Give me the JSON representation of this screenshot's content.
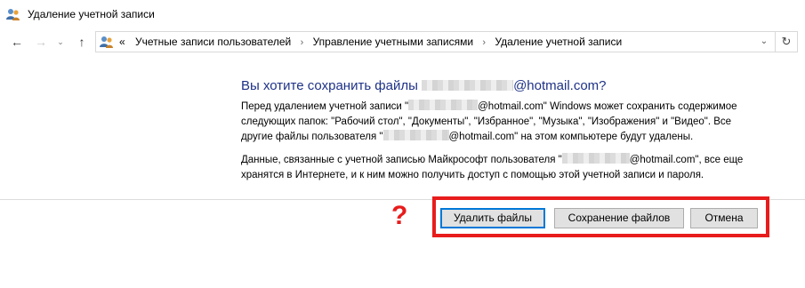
{
  "window": {
    "title": "Удаление учетной записи"
  },
  "nav": {
    "back_icon": "arrow-left-icon",
    "forward_icon": "arrow-right-icon",
    "recent_icon": "chevron-down-icon",
    "up_icon": "arrow-up-icon"
  },
  "address": {
    "overflow": "«",
    "breadcrumbs": [
      "Учетные записи пользователей",
      "Управление учетными записями",
      "Удаление учетной записи"
    ],
    "separator": "›",
    "dropdown_icon": "chevron-down-icon",
    "refresh_icon": "refresh-icon"
  },
  "content": {
    "heading_pre": "Вы хотите сохранить файлы ",
    "heading_post": "@hotmail.com?",
    "p1_a": "Перед удалением учетной записи \"",
    "p1_b": "@hotmail.com\" Windows может сохранить содержимое следующих папок: \"Рабочий стол\", \"Документы\", \"Избранное\", \"Музыка\", \"Изображения\" и \"Видео\". Все другие файлы пользователя \"",
    "p1_c": "@hotmail.com\" на этом компьютере будут удалены.",
    "p2_a": "Данные, связанные с учетной записью Майкрософт пользователя \"",
    "p2_b": "@hotmail.com\", все еще хранятся в Интернете, и к ним можно получить доступ с помощью этой учетной записи и пароля."
  },
  "annotation": {
    "mark": "?",
    "color": "#e81c1c"
  },
  "buttons": {
    "delete": "Удалить файлы",
    "keep": "Сохранение файлов",
    "cancel": "Отмена"
  },
  "colors": {
    "heading": "#1e3287",
    "focus": "#0078d7",
    "highlight": "#e81c1c"
  }
}
